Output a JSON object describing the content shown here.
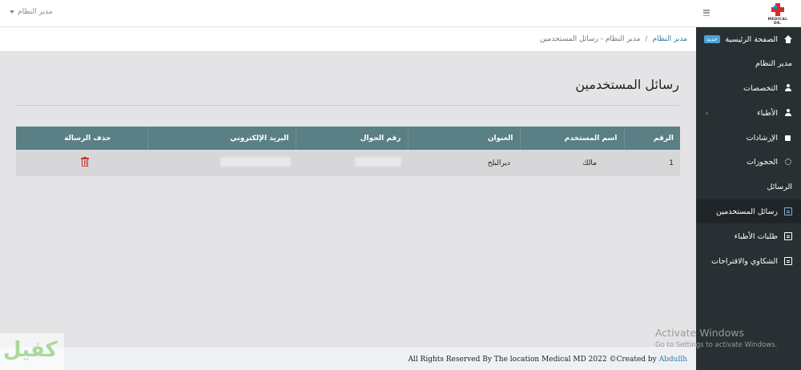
{
  "topbar": {
    "user_menu_label": "مدير النظام",
    "logo_text": "MEDICAL DR."
  },
  "breadcrumb": {
    "root": "مدير النظام",
    "separator": "/",
    "current": "مدير النظام - رسائل المستخدمين"
  },
  "page": {
    "title": "رسائل المستخدمين"
  },
  "table": {
    "headers": [
      "الرقم",
      "اسم المستخدم",
      "العنوان",
      "رقم الجوال",
      "البريد الإلكتروني",
      "حذف الرسالة"
    ],
    "rows": [
      {
        "number": "1",
        "username": "مالك",
        "address": "ديرالبلح"
      }
    ]
  },
  "sidebar": {
    "items": [
      {
        "label": "الصفحة الرئيسية",
        "badge": "جديد"
      },
      {
        "label": "مدير النظام"
      },
      {
        "label": "التخصصات"
      },
      {
        "label": "الأطباء",
        "chevron": "‹"
      },
      {
        "label": "الإرشادات"
      },
      {
        "label": "الحجوزات"
      },
      {
        "label": "الرسائل"
      },
      {
        "label": "رسائل المستخدمين"
      },
      {
        "label": "طلبات الأطباء"
      },
      {
        "label": "الشكاوي والاقتراحات"
      }
    ]
  },
  "footer": {
    "text": "All Rights Reserved By The location Medical MD 2022 ©Created by",
    "author": "Abdullh"
  },
  "os_overlay": {
    "title": "Activate Windows",
    "subtitle": "Go to Settings to activate Windows."
  },
  "watermark": {
    "text": "كفيل"
  },
  "colors": {
    "sidebar_bg": "#293034",
    "table_header_bg": "#5a7f84",
    "link": "#2a7fa8",
    "delete": "#c0392b",
    "badge": "#4aa3d6"
  }
}
